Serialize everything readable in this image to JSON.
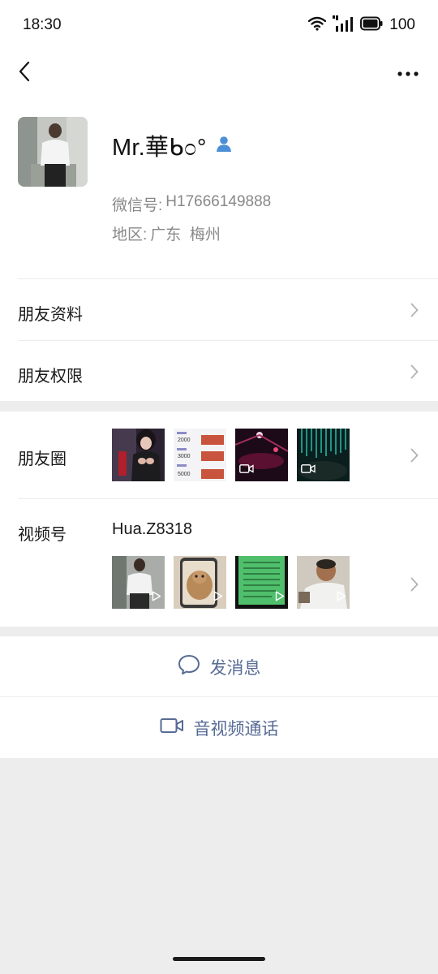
{
  "status_bar": {
    "time": "18:30",
    "battery": "100",
    "icons": [
      "wifi-icon",
      "cellular-signal-icon",
      "battery-icon"
    ]
  },
  "nav": {
    "back_icon": "chevron-left-icon",
    "more_icon": "more-dots-icon"
  },
  "profile": {
    "nickname": "Mr.華ᑲ೦°",
    "contact_badge_icon": "person-icon",
    "wechat_id_label": "微信号:",
    "wechat_id": "H17666149888",
    "region_label": "地区:",
    "region_value": "广东  梅州"
  },
  "rows": {
    "friend_profile": "朋友资料",
    "friend_permissions": "朋友权限"
  },
  "moments": {
    "label": "朋友圈",
    "thumbnails": [
      {
        "kind": "photo"
      },
      {
        "kind": "photo",
        "price_tags": [
          "2000",
          "3000",
          "5000"
        ]
      },
      {
        "kind": "video"
      },
      {
        "kind": "video"
      }
    ]
  },
  "channels": {
    "label": "视频号",
    "name": "Hua.Z8318",
    "thumbnails": [
      {
        "kind": "video"
      },
      {
        "kind": "video"
      },
      {
        "kind": "video"
      },
      {
        "kind": "video"
      }
    ]
  },
  "actions": {
    "send_message": "发消息",
    "av_call": "音视频通话"
  },
  "colors": {
    "link_blue": "#576b95",
    "background": "#ededed",
    "text_secondary": "#888888"
  }
}
